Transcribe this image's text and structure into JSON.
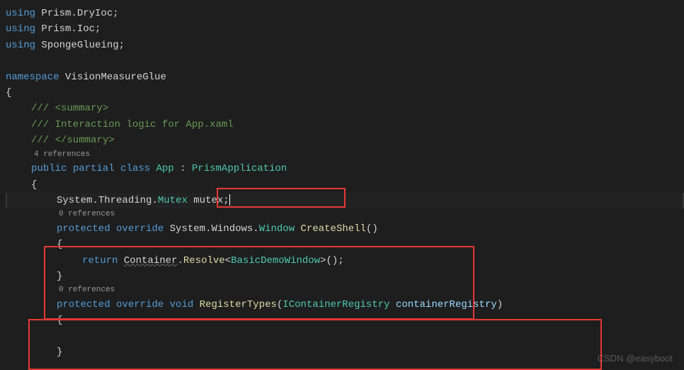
{
  "usings": [
    {
      "kw": "using",
      "ns": "Prism.DryIoc"
    },
    {
      "kw": "using",
      "ns": "Prism.Ioc"
    },
    {
      "kw": "using",
      "ns": "SpongeGlueing"
    }
  ],
  "namespace_kw": "namespace",
  "namespace_name": "VisionMeasureGlue",
  "doc": {
    "open": "/// <summary>",
    "body": "/// Interaction logic for App.xaml",
    "close": "/// </summary>"
  },
  "codelens": {
    "app": "4 references",
    "createshell": "0 references",
    "registertypes": "0 references"
  },
  "class_decl": {
    "access": "public",
    "partial": "partial",
    "class_kw": "class",
    "name": "App",
    "colon": " : ",
    "base": "PrismApplication"
  },
  "field": {
    "ns1": "System",
    "ns2": "Threading",
    "type": "Mutex",
    "name": "mutex"
  },
  "method1": {
    "access": "protected",
    "override": "override",
    "ret_ns1": "System",
    "ret_ns2": "Windows",
    "ret_type": "Window",
    "name": "CreateShell",
    "parens": "()",
    "return_kw": "return",
    "container": "Container",
    "resolve": "Resolve",
    "generic": "BasicDemoWindow",
    "tail": ">();"
  },
  "method2": {
    "access": "protected",
    "override": "override",
    "ret": "void",
    "name": "RegisterTypes",
    "lp": "(",
    "ptype": "IContainerRegistry",
    "pname": "containerRegistry",
    "rp": ")"
  },
  "watermark": "CSDN @easyboot"
}
